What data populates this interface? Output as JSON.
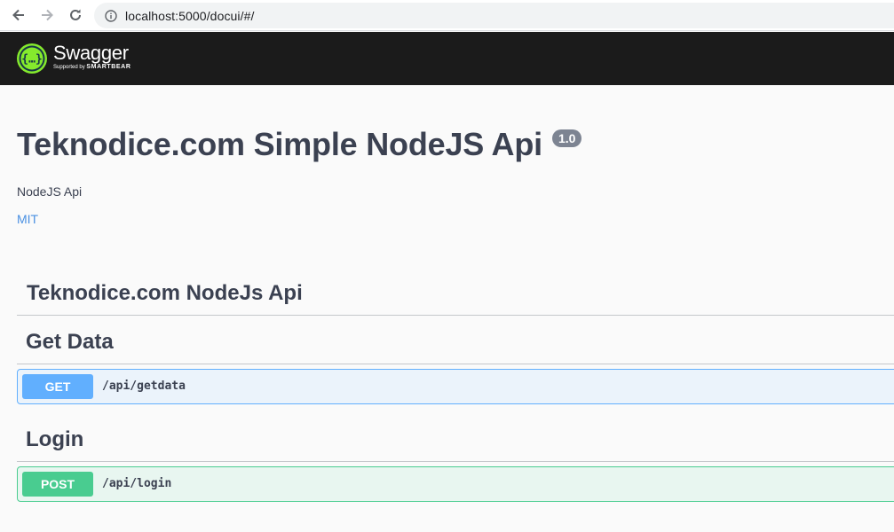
{
  "browser": {
    "url": "localhost:5000/docui/#/"
  },
  "topbar": {
    "logo_title": "Swagger",
    "logo_sub_prefix": "Supported by",
    "logo_sub_brand": "SMARTBEAR"
  },
  "info": {
    "title": "Teknodice.com Simple NodeJS Api",
    "version": "1.0",
    "description": "NodeJS Api",
    "license": "MIT"
  },
  "tags": [
    {
      "name": "Teknodice.com NodeJs Api",
      "operations": []
    },
    {
      "name": "Get Data",
      "operations": [
        {
          "method": "GET",
          "path": "/api/getdata"
        }
      ]
    },
    {
      "name": "Login",
      "operations": [
        {
          "method": "POST",
          "path": "/api/login"
        }
      ]
    }
  ],
  "colors": {
    "get": "#61affe",
    "post": "#49cc90",
    "logo": "#85ea2d",
    "topbar": "#1b1b1b"
  }
}
